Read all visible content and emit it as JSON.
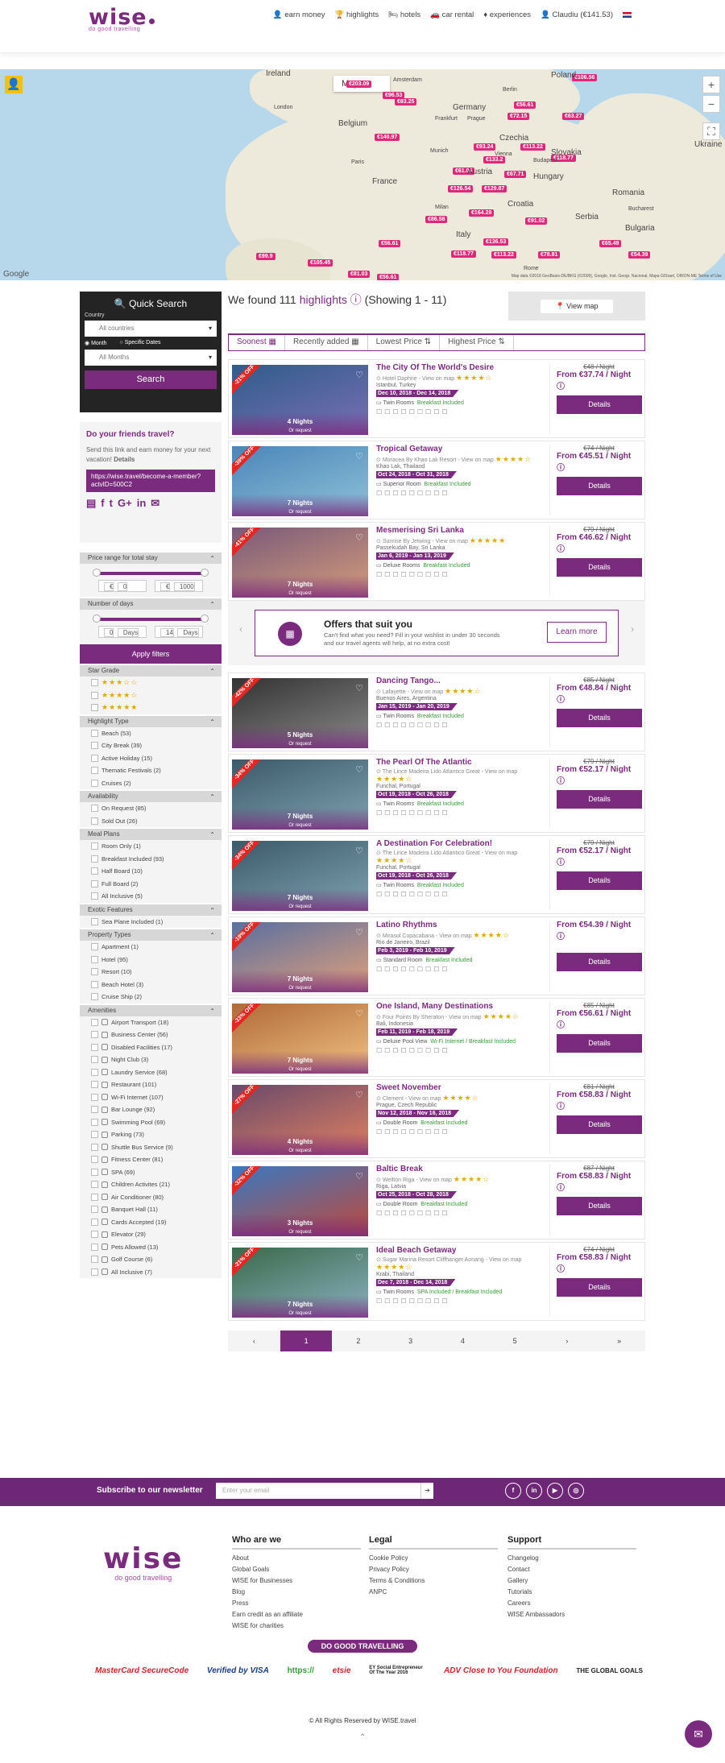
{
  "header": {
    "logo": "wise",
    "tagline": "do good travelling",
    "nav": [
      {
        "icon": "user-icon",
        "label": "earn money"
      },
      {
        "icon": "trophy-icon",
        "label": "highlights"
      },
      {
        "icon": "bed-icon",
        "label": "hotels"
      },
      {
        "icon": "car-icon",
        "label": "car rental"
      },
      {
        "icon": "diamond-icon",
        "label": "experiences"
      },
      {
        "icon": "account-icon",
        "label": "Claudiu (€141.53)"
      }
    ]
  },
  "map": {
    "type_label": "Map",
    "zoom_in": "+",
    "zoom_out": "−",
    "pins": [
      "€106.56",
      "€96.53",
      "€83.25",
      "€56.61",
      "€72.15",
      "€63.27",
      "€140.97",
      "€93.24",
      "€113.22",
      "€133.2",
      "€118.77",
      "€61.05",
      "€126.54",
      "€129.87",
      "€67.71",
      "€86.58",
      "€164.28",
      "€91.02",
      "€136.53",
      "€113.22",
      "€78.81",
      "€65.49",
      "€99.9",
      "€54.39",
      "€105.45",
      "€81.03",
      "€56.61",
      "€118.77",
      "€56.61",
      "€203.09"
    ],
    "countries": [
      "Ireland",
      "Poland",
      "Germany",
      "France",
      "Czechia",
      "Slovakia",
      "Austria",
      "Hungary",
      "Romania",
      "Ukraine",
      "Italy",
      "Croatia",
      "Serbia",
      "Bulgaria",
      "Belgium",
      "Amsterdam",
      "Berlin",
      "Frankfurt",
      "Prague",
      "Vienna",
      "Munich",
      "Budapest",
      "Bucharest",
      "Paris",
      "Milan",
      "Rome",
      "London"
    ],
    "google": "Google",
    "attribution": "Map data ©2018 GeoBasis-DE/BKG (©2009), Google, Inst. Geogr. Nacional, Mapa GISrael, ORION-ME   Terms of Use"
  },
  "quick_search": {
    "title": "Quick Search",
    "country_label": "Country",
    "country_value": "All countries",
    "radio_month": "Month",
    "radio_dates": "Specific Dates",
    "month_value": "All Months",
    "search_button": "Search"
  },
  "friends": {
    "title": "Do your friends travel?",
    "text": "Send this link and earn money for your next vacation!",
    "details": "Details",
    "link": "https://wise.travel/become-a-member?actvID=500C2",
    "social": [
      "fb-doc",
      "f",
      "t",
      "G+",
      "in",
      "✉"
    ]
  },
  "filters": {
    "price_title": "Price range for total stay",
    "price_min": "0",
    "price_max": "1000",
    "currency": "€",
    "days_title": "Number of days",
    "days_min": "0",
    "days_max": "14",
    "days_unit": "Days",
    "apply": "Apply filters",
    "star_title": "Star Grade",
    "stars": [
      "★★★☆☆",
      "★★★★☆",
      "★★★★★"
    ],
    "highlight_title": "Highlight Type",
    "highlight": [
      "Beach (53)",
      "City Break (39)",
      "Active Holiday (15)",
      "Thematic Festivals (2)",
      "Cruises (2)"
    ],
    "availability_title": "Availability",
    "availability": [
      "On Request (85)",
      "Sold Out (26)"
    ],
    "meal_title": "Meal Plans",
    "meal": [
      "Room Only (1)",
      "Breakfast Included (93)",
      "Half Board (10)",
      "Full Board (2)",
      "All Inclusive (5)"
    ],
    "exotic_title": "Exotic Features",
    "exotic": [
      "Sea Plane Included (1)"
    ],
    "property_title": "Property Types",
    "property": [
      "Apartment (1)",
      "Hotel (95)",
      "Resort (10)",
      "Beach Hotel (3)",
      "Cruise Ship (2)"
    ],
    "amenities_title": "Amenities",
    "amenities": [
      "Airport Transport (18)",
      "Business Center (56)",
      "Disabled Facilities (17)",
      "Night Club (3)",
      "Laundry Service (68)",
      "Restaurant (101)",
      "Wi-Fi Internet (107)",
      "Bar Lounge (92)",
      "Swimming Pool (69)",
      "Parking (73)",
      "Shuttle Bus Service (9)",
      "Fitness Center (81)",
      "SPA (69)",
      "Children Activites (21)",
      "Air Conditioner (80)",
      "Banquet Hall (11)",
      "Cards Accepted (19)",
      "Elevator (29)",
      "Pets Allowed (13)",
      "Golf Course (6)",
      "All Inclusive (7)"
    ]
  },
  "results": {
    "found_prefix": "We found",
    "count": "111",
    "highlights_word": "highlights",
    "showing": "(Showing 1 - 11)",
    "view_map": "View map",
    "sort": [
      "Soonest",
      "Recently added",
      "Lowest Price",
      "Highest Price"
    ],
    "cards": [
      {
        "badge": "-21% OFF",
        "title": "The City Of The World's Desire",
        "hotel": "Hotel Daphne - View on map",
        "stars": "★★★★☆",
        "location": "Istanbul, Turkey",
        "dates": "Dec 10, 2018 - Dec 14, 2018",
        "room": "Twin Rooms",
        "meal": "Breakfast Included",
        "nights": "4 Nights",
        "request": "Or request",
        "old": "€48 / Night",
        "price": "From €37.74 / Night",
        "details": "Details",
        "color1": "#2f5c8a",
        "color2": "#7a6fb3"
      },
      {
        "badge": "-39% OFF",
        "title": "Tropical Getaway",
        "hotel": "Moracea By Khao Lak Resort - View on map",
        "stars": "★★★★☆",
        "location": "Khao Lak, Thailand",
        "dates": "Oct 24, 2018 - Oct 31, 2018",
        "room": "Superior Room",
        "meal": "Breakfast Included",
        "nights": "7 Nights",
        "request": "Or request",
        "old": "€74 / Night",
        "price": "From €45.51 / Night",
        "details": "Details",
        "color1": "#4a86b8",
        "color2": "#8fc1d8"
      },
      {
        "badge": "-41% OFF",
        "title": "Mesmerising Sri Lanka",
        "hotel": "Sunrise By Jetwing - View on map",
        "stars": "★★★★★",
        "location": "Passekudah Bay, Sri Lanka",
        "dates": "Jan 6, 2019 - Jan 13, 2019",
        "room": "Deluxe Rooms",
        "meal": "Breakfast Included",
        "nights": "7 Nights",
        "request": "Or request",
        "old": "€79 / Night",
        "price": "From €46.62 / Night",
        "details": "Details",
        "color1": "#7a5a7a",
        "color2": "#d49c7a"
      },
      {
        "badge": "-42% OFF",
        "title": "Dancing Tango...",
        "hotel": "Lafayette - View on map",
        "stars": "★★★★☆",
        "location": "Buenos Aires, Argentina",
        "dates": "Jan 15, 2019 - Jan 20, 2019",
        "room": "Twin Rooms",
        "meal": "Breakfast Included",
        "nights": "5 Nights",
        "request": "Or request",
        "old": "€85 / Night",
        "price": "From €48.84 / Night",
        "details": "Details",
        "color1": "#333333",
        "color2": "#888888"
      },
      {
        "badge": "-34% OFF",
        "title": "The Pearl Of The Atlantic",
        "hotel": "The Lince Madeira Lido Atlantico Great - View on map",
        "stars": "★★★★☆",
        "location": "Funchal, Portugal",
        "dates": "Oct 19, 2018 - Oct 26, 2018",
        "room": "Twin Rooms",
        "meal": "Breakfast Included",
        "nights": "7 Nights",
        "request": "Or request",
        "old": "€79 / Night",
        "price": "From €52.17 / Night",
        "details": "Details",
        "color1": "#3b5a6a",
        "color2": "#7fa3b0"
      },
      {
        "badge": "-34% OFF",
        "title": "A Destination For Celebration!",
        "hotel": "The Lince Madeira Lido Atlantico Great - View on map",
        "stars": "★★★★☆",
        "location": "Funchal, Portugal",
        "dates": "Oct 19, 2018 - Oct 26, 2018",
        "room": "Twin Rooms",
        "meal": "Breakfast Included",
        "nights": "7 Nights",
        "request": "Or request",
        "old": "€79 / Night",
        "price": "From €52.17 / Night",
        "details": "Details",
        "color1": "#3b5a6a",
        "color2": "#7fa3b0"
      },
      {
        "badge": "-19% OFF",
        "title": "Latino Rhythms",
        "hotel": "Mirasol Copacabana - View on map",
        "stars": "★★★★☆",
        "location": "Rio de Janeiro, Brazil",
        "dates": "Feb 3, 2019 - Feb 10, 2019",
        "room": "Standard Room",
        "meal": "Breakfast Included",
        "nights": "7 Nights",
        "request": "Or request",
        "old": "",
        "price": "From €54.39 / Night",
        "details": "Details",
        "color1": "#5a6fa0",
        "color2": "#e0a07a"
      },
      {
        "badge": "-33% OFF",
        "title": "One Island, Many Destinations",
        "hotel": "Four Points By Sheraton - View on map",
        "stars": "★★★★☆",
        "location": "Bali, Indonesia",
        "dates": "Feb 11, 2019 - Feb 18, 2019",
        "room": "Deluxe Pool View",
        "meal": "Wi-Fi Internet / Breakfast Included",
        "nights": "7 Nights",
        "request": "Or request",
        "old": "€85 / Night",
        "price": "From €56.61 / Night",
        "details": "Details",
        "color1": "#b06a3a",
        "color2": "#f0c080"
      },
      {
        "badge": "-27% OFF",
        "title": "Sweet November",
        "hotel": "Clement - View on map",
        "stars": "★★★★☆",
        "location": "Prague, Czech Republic",
        "dates": "Nov 12, 2018 - Nov 16, 2018",
        "room": "Double Room",
        "meal": "Breakfast Included",
        "nights": "4 Nights",
        "request": "Or request",
        "old": "€81 / Night",
        "price": "From €58.83 / Night",
        "details": "Details",
        "color1": "#6a4a6a",
        "color2": "#e08060"
      },
      {
        "badge": "-32% OFF",
        "title": "Baltic Break",
        "hotel": "Wellton Riga - View on map",
        "stars": "★★★★☆",
        "location": "Riga, Latvia",
        "dates": "Oct 25, 2018 - Oct 28, 2018",
        "room": "Double Room",
        "meal": "Breakfast Included",
        "nights": "3 Nights",
        "request": "Or request",
        "old": "€87 / Night",
        "price": "From €58.83 / Night",
        "details": "Details",
        "color1": "#3a78c0",
        "color2": "#c04a3a"
      },
      {
        "badge": "-21% OFF",
        "title": "Ideal Beach Getaway",
        "hotel": "Sugar Marina Resort Cliffhanger Aonang - View on map",
        "stars": "★★★★☆",
        "location": "Krabi, Thailand",
        "dates": "Dec 7, 2018 - Dec 14, 2018",
        "room": "Twin Rooms",
        "meal": "SPA Included / Breakfast Included",
        "nights": "7 Nights",
        "request": "Or request",
        "old": "€74 / Night",
        "price": "From €58.83 / Night",
        "details": "Details",
        "color1": "#3a6a4a",
        "color2": "#8ab0c0"
      }
    ],
    "offers": {
      "title": "Offers that suit you",
      "text": "Can't find what you need? Fill in your wishlist in under 30 seconds and our travel agents will help, at no extra cost!",
      "button": "Learn more"
    },
    "pager": [
      "‹",
      "1",
      "2",
      "3",
      "4",
      "5",
      "›",
      "»"
    ]
  },
  "newsletter": {
    "title": "Subscribe to our newsletter",
    "placeholder": "Enter your email",
    "social": [
      "f",
      "in",
      "▶",
      "◎"
    ]
  },
  "footer": {
    "logo": "wise",
    "tagline": "do good travelling",
    "who_title": "Who are we",
    "who": [
      "About",
      "Global Goals",
      "WISE for Businesses",
      "Blog",
      "Press",
      "Earn credit as an affiliate",
      "WISE for charities"
    ],
    "legal_title": "Legal",
    "legal": [
      "Cookie Policy",
      "Privacy Policy",
      "Terms & Conditions",
      "ANPC"
    ],
    "support_title": "Support",
    "support": [
      "Changelog",
      "Contact",
      "Gallery",
      "Tutorials",
      "Careers",
      "WISE Ambassadors"
    ],
    "cta": "DO GOOD TRAVELLING",
    "partners": [
      "MasterCard SecureCode",
      "Verified by VISA",
      "https://",
      "etsie",
      "EY Social Entrepreneur Of The Year 2016",
      "ADV Close to You Foundation",
      "THE GLOBAL GOALS"
    ],
    "copyright": "© All Rights Reserved by WISE.travel"
  }
}
